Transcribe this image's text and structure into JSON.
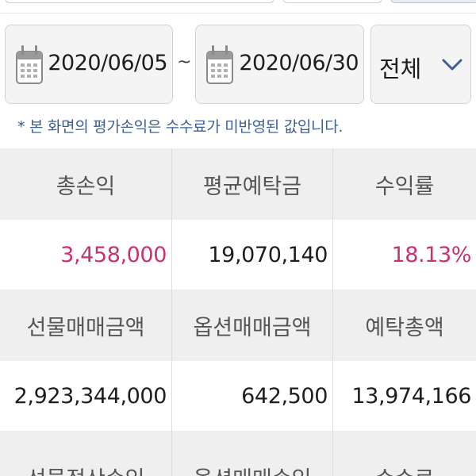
{
  "filter": {
    "start_date": "2020/06/05",
    "separator": "~",
    "end_date": "2020/06/30",
    "scope_select": "전체"
  },
  "notice": "* 본 화면의 평가손익은 수수료가 미반영된 값입니다.",
  "summary": {
    "row1_headers": [
      "총손익",
      "평균예탁금",
      "수익률"
    ],
    "row1_values": [
      "3,458,000",
      "19,070,140",
      "18.13%"
    ],
    "row2_headers": [
      "선물매매금액",
      "옵션매매금액",
      "예탁총액"
    ],
    "row2_values": [
      "2,923,344,000",
      "642,500",
      "13,974,166"
    ],
    "row3_headers": [
      "선물정산손익",
      "옵션매매손익",
      "수수료"
    ]
  },
  "colors": {
    "profit_highlight": "#c7326f",
    "notice_text": "#3d5f96",
    "header_bg": "#efefef",
    "chevron": "#3d5f96"
  },
  "icons": {
    "calendar": "calendar-icon",
    "dropdown": "chevron-down-icon"
  }
}
